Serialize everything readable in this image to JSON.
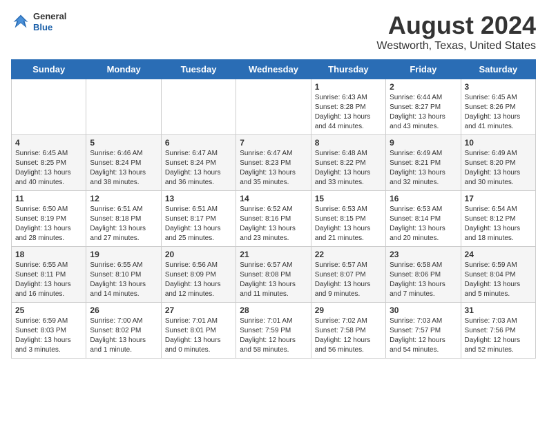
{
  "header": {
    "logo_general": "General",
    "logo_blue": "Blue",
    "title": "August 2024",
    "subtitle": "Westworth, Texas, United States"
  },
  "weekdays": [
    "Sunday",
    "Monday",
    "Tuesday",
    "Wednesday",
    "Thursday",
    "Friday",
    "Saturday"
  ],
  "weeks": [
    [
      {
        "day": "",
        "info": ""
      },
      {
        "day": "",
        "info": ""
      },
      {
        "day": "",
        "info": ""
      },
      {
        "day": "",
        "info": ""
      },
      {
        "day": "1",
        "info": "Sunrise: 6:43 AM\nSunset: 8:28 PM\nDaylight: 13 hours\nand 44 minutes."
      },
      {
        "day": "2",
        "info": "Sunrise: 6:44 AM\nSunset: 8:27 PM\nDaylight: 13 hours\nand 43 minutes."
      },
      {
        "day": "3",
        "info": "Sunrise: 6:45 AM\nSunset: 8:26 PM\nDaylight: 13 hours\nand 41 minutes."
      }
    ],
    [
      {
        "day": "4",
        "info": "Sunrise: 6:45 AM\nSunset: 8:25 PM\nDaylight: 13 hours\nand 40 minutes."
      },
      {
        "day": "5",
        "info": "Sunrise: 6:46 AM\nSunset: 8:24 PM\nDaylight: 13 hours\nand 38 minutes."
      },
      {
        "day": "6",
        "info": "Sunrise: 6:47 AM\nSunset: 8:24 PM\nDaylight: 13 hours\nand 36 minutes."
      },
      {
        "day": "7",
        "info": "Sunrise: 6:47 AM\nSunset: 8:23 PM\nDaylight: 13 hours\nand 35 minutes."
      },
      {
        "day": "8",
        "info": "Sunrise: 6:48 AM\nSunset: 8:22 PM\nDaylight: 13 hours\nand 33 minutes."
      },
      {
        "day": "9",
        "info": "Sunrise: 6:49 AM\nSunset: 8:21 PM\nDaylight: 13 hours\nand 32 minutes."
      },
      {
        "day": "10",
        "info": "Sunrise: 6:49 AM\nSunset: 8:20 PM\nDaylight: 13 hours\nand 30 minutes."
      }
    ],
    [
      {
        "day": "11",
        "info": "Sunrise: 6:50 AM\nSunset: 8:19 PM\nDaylight: 13 hours\nand 28 minutes."
      },
      {
        "day": "12",
        "info": "Sunrise: 6:51 AM\nSunset: 8:18 PM\nDaylight: 13 hours\nand 27 minutes."
      },
      {
        "day": "13",
        "info": "Sunrise: 6:51 AM\nSunset: 8:17 PM\nDaylight: 13 hours\nand 25 minutes."
      },
      {
        "day": "14",
        "info": "Sunrise: 6:52 AM\nSunset: 8:16 PM\nDaylight: 13 hours\nand 23 minutes."
      },
      {
        "day": "15",
        "info": "Sunrise: 6:53 AM\nSunset: 8:15 PM\nDaylight: 13 hours\nand 21 minutes."
      },
      {
        "day": "16",
        "info": "Sunrise: 6:53 AM\nSunset: 8:14 PM\nDaylight: 13 hours\nand 20 minutes."
      },
      {
        "day": "17",
        "info": "Sunrise: 6:54 AM\nSunset: 8:12 PM\nDaylight: 13 hours\nand 18 minutes."
      }
    ],
    [
      {
        "day": "18",
        "info": "Sunrise: 6:55 AM\nSunset: 8:11 PM\nDaylight: 13 hours\nand 16 minutes."
      },
      {
        "day": "19",
        "info": "Sunrise: 6:55 AM\nSunset: 8:10 PM\nDaylight: 13 hours\nand 14 minutes."
      },
      {
        "day": "20",
        "info": "Sunrise: 6:56 AM\nSunset: 8:09 PM\nDaylight: 13 hours\nand 12 minutes."
      },
      {
        "day": "21",
        "info": "Sunrise: 6:57 AM\nSunset: 8:08 PM\nDaylight: 13 hours\nand 11 minutes."
      },
      {
        "day": "22",
        "info": "Sunrise: 6:57 AM\nSunset: 8:07 PM\nDaylight: 13 hours\nand 9 minutes."
      },
      {
        "day": "23",
        "info": "Sunrise: 6:58 AM\nSunset: 8:06 PM\nDaylight: 13 hours\nand 7 minutes."
      },
      {
        "day": "24",
        "info": "Sunrise: 6:59 AM\nSunset: 8:04 PM\nDaylight: 13 hours\nand 5 minutes."
      }
    ],
    [
      {
        "day": "25",
        "info": "Sunrise: 6:59 AM\nSunset: 8:03 PM\nDaylight: 13 hours\nand 3 minutes."
      },
      {
        "day": "26",
        "info": "Sunrise: 7:00 AM\nSunset: 8:02 PM\nDaylight: 13 hours\nand 1 minute."
      },
      {
        "day": "27",
        "info": "Sunrise: 7:01 AM\nSunset: 8:01 PM\nDaylight: 13 hours\nand 0 minutes."
      },
      {
        "day": "28",
        "info": "Sunrise: 7:01 AM\nSunset: 7:59 PM\nDaylight: 12 hours\nand 58 minutes."
      },
      {
        "day": "29",
        "info": "Sunrise: 7:02 AM\nSunset: 7:58 PM\nDaylight: 12 hours\nand 56 minutes."
      },
      {
        "day": "30",
        "info": "Sunrise: 7:03 AM\nSunset: 7:57 PM\nDaylight: 12 hours\nand 54 minutes."
      },
      {
        "day": "31",
        "info": "Sunrise: 7:03 AM\nSunset: 7:56 PM\nDaylight: 12 hours\nand 52 minutes."
      }
    ]
  ]
}
